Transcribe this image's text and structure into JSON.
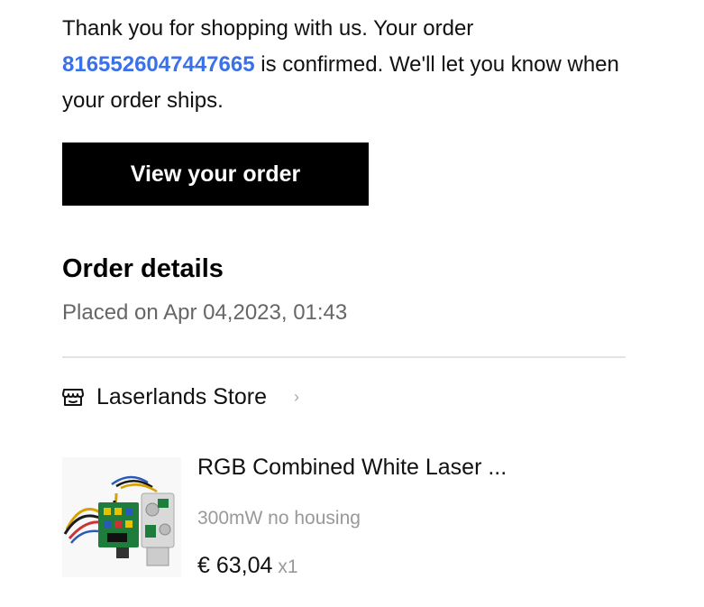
{
  "intro": {
    "text_before": "Thank you for shopping with us. Your order ",
    "order_number": "8165526047447665",
    "text_after": " is confirmed. We'll let you know when your order ships."
  },
  "view_order_button": "View your order",
  "order_details": {
    "title": "Order details",
    "placed_on": "Placed on Apr 04,2023, 01:43"
  },
  "store": {
    "icon": "store-icon",
    "name": "Laserlands Store",
    "chevron": "›"
  },
  "product": {
    "title": "RGB Combined White Laser ...",
    "variant": "300mW no housing",
    "price": "€ 63,04",
    "quantity": "x1"
  },
  "colors": {
    "link": "#3b71e8",
    "button_bg": "#000000",
    "button_text": "#ffffff",
    "muted_text": "#666666",
    "divider": "#e3e3e3"
  }
}
